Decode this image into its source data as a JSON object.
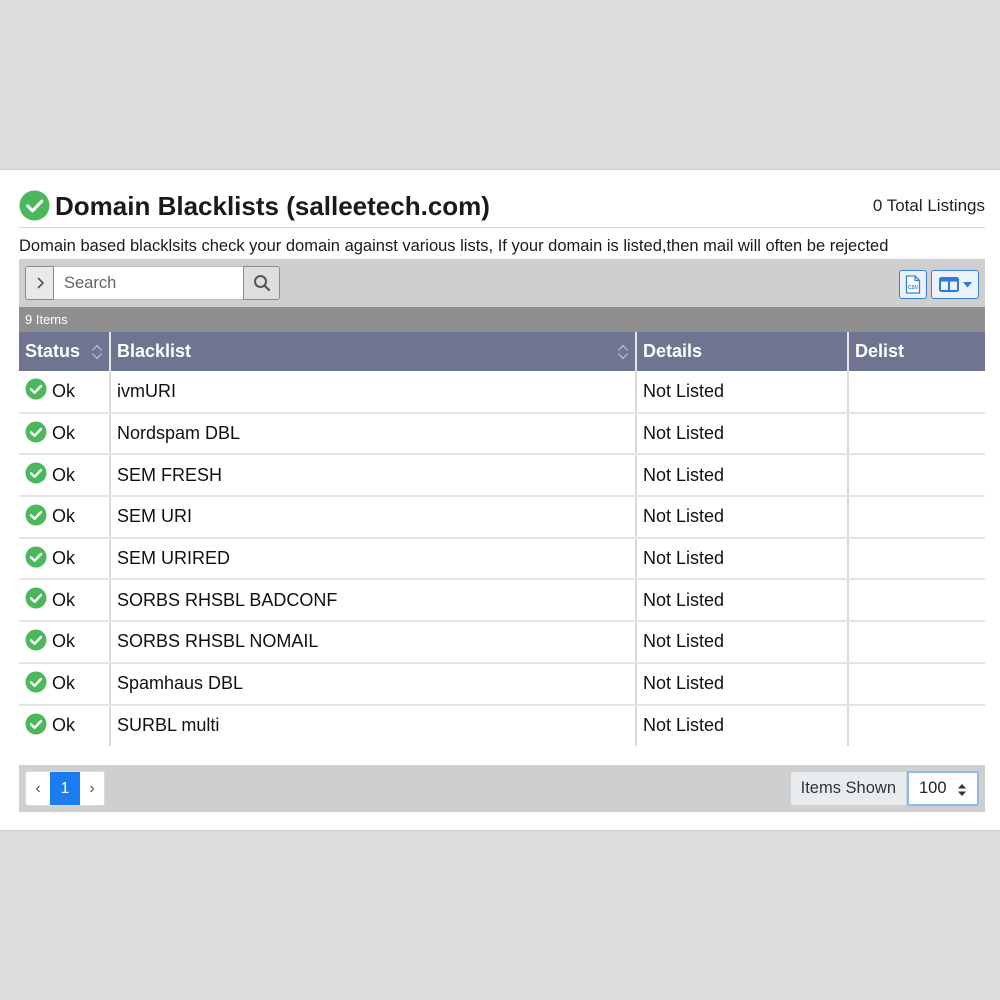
{
  "header": {
    "title": "Domain Blacklists (salleetech.com)",
    "total_listings": "0 Total Listings",
    "description": "Domain based blacklsits check your domain against various lists, If your domain is listed,then mail will often be rejected"
  },
  "toolbar": {
    "search_placeholder": "Search",
    "csv_label": "CSV"
  },
  "table": {
    "item_count": "9 Items",
    "columns": [
      "Status",
      "Blacklist",
      "Details",
      "Delist"
    ],
    "rows": [
      {
        "status": "Ok",
        "blacklist": "ivmURI",
        "details": "Not Listed",
        "delist": ""
      },
      {
        "status": "Ok",
        "blacklist": "Nordspam DBL",
        "details": "Not Listed",
        "delist": ""
      },
      {
        "status": "Ok",
        "blacklist": "SEM FRESH",
        "details": "Not Listed",
        "delist": ""
      },
      {
        "status": "Ok",
        "blacklist": "SEM URI",
        "details": "Not Listed",
        "delist": ""
      },
      {
        "status": "Ok",
        "blacklist": "SEM URIRED",
        "details": "Not Listed",
        "delist": ""
      },
      {
        "status": "Ok",
        "blacklist": "SORBS RHSBL BADCONF",
        "details": "Not Listed",
        "delist": ""
      },
      {
        "status": "Ok",
        "blacklist": "SORBS RHSBL NOMAIL",
        "details": "Not Listed",
        "delist": ""
      },
      {
        "status": "Ok",
        "blacklist": "Spamhaus DBL",
        "details": "Not Listed",
        "delist": ""
      },
      {
        "status": "Ok",
        "blacklist": "SURBL multi",
        "details": "Not Listed",
        "delist": ""
      }
    ]
  },
  "footer": {
    "prev_label": "‹",
    "current_page": "1",
    "next_label": "›",
    "items_shown_label": "Items Shown",
    "items_shown_value": "100"
  },
  "colors": {
    "ok_green": "#4cb85c",
    "header_purple": "#6f7491",
    "accent_blue": "#1a7cf0"
  },
  "icons": [
    "check-circle-icon",
    "chevron-right-icon",
    "search-icon",
    "csv-file-icon",
    "columns-icon",
    "sort-icon"
  ]
}
